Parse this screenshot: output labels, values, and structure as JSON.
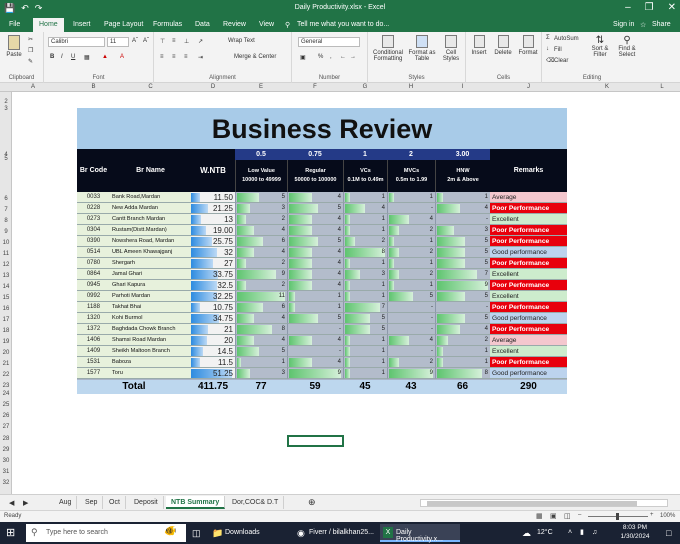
{
  "window": {
    "title": "Daily Productivity.xlsx - Excel"
  },
  "menu": {
    "file": "File",
    "tabs": [
      "Home",
      "Insert",
      "Page Layout",
      "Formulas",
      "Data",
      "Review",
      "View"
    ],
    "tell": "Tell me what you want to do...",
    "signin": "Sign in",
    "share": "Share"
  },
  "ribbon": {
    "paste": "Paste",
    "clipboard": "Clipboard",
    "font_name": "Calibri",
    "font_size": "11",
    "bold": "B",
    "italic": "I",
    "underline": "U",
    "font_label": "Font",
    "wrap": "Wrap Text",
    "merge": "Merge & Center",
    "alignment_label": "Alignment",
    "number_format": "General",
    "pct": "%",
    "comma": ",",
    "number_label": "Number",
    "conditional": "Conditional Formatting",
    "format_table": "Format as Table",
    "cell_styles": "Cell Styles",
    "styles_label": "Styles",
    "insert": "Insert",
    "delete": "Delete",
    "format": "Format",
    "cells_label": "Cells",
    "autosum": "AutoSum",
    "fill": "Fill",
    "clear": "Clear",
    "sort": "Sort & Filter",
    "find": "Find & Select",
    "editing_label": "Editing"
  },
  "columns": [
    "A",
    "B",
    "C",
    "D",
    "E",
    "F",
    "G",
    "H",
    "I",
    "J",
    "K",
    "L"
  ],
  "rows": [
    "2",
    "3",
    "4",
    "5",
    "6",
    "7",
    "8",
    "9",
    "10",
    "11",
    "12",
    "13",
    "14",
    "15",
    "16",
    "17",
    "18",
    "19",
    "20",
    "21",
    "22",
    "23",
    "24",
    "25",
    "26",
    "27",
    "28",
    "29",
    "30",
    "31",
    "32"
  ],
  "report": {
    "title": "Business Review",
    "headers": {
      "code": "Br Code",
      "name": "Br Name",
      "ntb": "W.NTB",
      "remarks": "Remarks"
    },
    "weights": [
      "0.5",
      "0.75",
      "1",
      "2",
      "3.00"
    ],
    "categories": [
      {
        "l1": "Low Value",
        "l2": "10000 to 49999"
      },
      {
        "l1": "Regular",
        "l2": "50000 to 100000"
      },
      {
        "l1": "VCs",
        "l2": "0.1M to 0.49m"
      },
      {
        "l1": "MVCs",
        "l2": "0.5m to 1.99"
      },
      {
        "l1": "HNW",
        "l2": "2m & Above"
      }
    ],
    "rows": [
      {
        "code": "0033",
        "name": "Bank Road,Mardan",
        "ntb": "11.50",
        "lv": "5",
        "reg": "4",
        "vc": "1",
        "mvc": "1",
        "hnw": "1",
        "remark": "Average"
      },
      {
        "code": "0228",
        "name": "New Adda Mardan",
        "ntb": "21.25",
        "lv": "3",
        "reg": "5",
        "vc": "4",
        "mvc": "-",
        "hnw": "4",
        "remark": "Poor Performance"
      },
      {
        "code": "0273",
        "name": "Cantt Branch Mardan",
        "ntb": "13",
        "lv": "2",
        "reg": "4",
        "vc": "1",
        "mvc": "4",
        "hnw": "-",
        "remark": "Excellent"
      },
      {
        "code": "0304",
        "name": "Rustam(Distt.Mardan)",
        "ntb": "19.00",
        "lv": "4",
        "reg": "4",
        "vc": "1",
        "mvc": "2",
        "hnw": "3",
        "remark": "Poor Performance"
      },
      {
        "code": "0390",
        "name": "Nowshera Road, Mardan",
        "ntb": "25.75",
        "lv": "6",
        "reg": "5",
        "vc": "2",
        "mvc": "1",
        "hnw": "5",
        "remark": "Poor Performance"
      },
      {
        "code": "0514",
        "name": "UBL Ameen Khawajganj",
        "ntb": "32",
        "lv": "4",
        "reg": "4",
        "vc": "8",
        "mvc": "2",
        "hnw": "5",
        "remark": "Good performance"
      },
      {
        "code": "0780",
        "name": "Shergarh",
        "ntb": "27",
        "lv": "2",
        "reg": "4",
        "vc": "1",
        "mvc": "1",
        "hnw": "5",
        "remark": "Poor Performance"
      },
      {
        "code": "0864",
        "name": "Jamal Ghari",
        "ntb": "33.75",
        "lv": "9",
        "reg": "4",
        "vc": "3",
        "mvc": "2",
        "hnw": "7",
        "remark": "Excellent"
      },
      {
        "code": "0945",
        "name": "Ghari Kapura",
        "ntb": "32.5",
        "lv": "2",
        "reg": "4",
        "vc": "1",
        "mvc": "1",
        "hnw": "9",
        "remark": "Poor Performance"
      },
      {
        "code": "0992",
        "name": "Parhoti Mardan",
        "ntb": "32.25",
        "lv": "11",
        "reg": "1",
        "vc": "1",
        "mvc": "5",
        "hnw": "5",
        "remark": "Excellent"
      },
      {
        "code": "1188",
        "name": "Takhat Bhai",
        "ntb": "10.75",
        "lv": "6",
        "reg": "1",
        "vc": "7",
        "mvc": "-",
        "hnw": "-",
        "remark": "Poor Performance"
      },
      {
        "code": "1320",
        "name": "Kohi Burmol",
        "ntb": "34.75",
        "lv": "4",
        "reg": "5",
        "vc": "5",
        "mvc": "-",
        "hnw": "5",
        "remark": "Good performance"
      },
      {
        "code": "1372",
        "name": "Baghdada Chowk Branch",
        "ntb": "21",
        "lv": "8",
        "reg": "-",
        "vc": "5",
        "mvc": "-",
        "hnw": "4",
        "remark": "Poor Performance"
      },
      {
        "code": "1406",
        "name": "Shamsi Road Mardan",
        "ntb": "20",
        "lv": "4",
        "reg": "4",
        "vc": "1",
        "mvc": "4",
        "hnw": "2",
        "remark": "Average"
      },
      {
        "code": "1409",
        "name": "Sheikh Maltoon Branch",
        "ntb": "14.5",
        "lv": "5",
        "reg": "-",
        "vc": "1",
        "mvc": "-",
        "hnw": "1",
        "remark": "Excellent"
      },
      {
        "code": "1531",
        "name": "Baboza",
        "ntb": "11.5",
        "lv": "1",
        "reg": "4",
        "vc": "1",
        "mvc": "2",
        "hnw": "1",
        "remark": "Poor Performance"
      },
      {
        "code": "1577",
        "name": "Toru",
        "ntb": "51.25",
        "lv": "3",
        "reg": "9",
        "vc": "1",
        "mvc": "9",
        "hnw": "8",
        "remark": "Good performance"
      }
    ],
    "total": {
      "label": "Total",
      "ntb": "411.75",
      "lv": "77",
      "reg": "59",
      "vc": "45",
      "mvc": "43",
      "hnw": "66",
      "remarks": "290"
    }
  },
  "remark_colors": {
    "Average": "#f4c7ce",
    "Poor Performance": "#e8000c",
    "Excellent": "#cdeccd",
    "Good performance": "#bcd3ee"
  },
  "sheets": [
    "Aug",
    "Sep",
    "Oct",
    "Deposit",
    "NTB Summary",
    "Dor,COC& D.T"
  ],
  "status": {
    "ready": "Ready",
    "zoom": "100%"
  },
  "taskbar": {
    "search": "Type here to search",
    "downloads": "Downloads",
    "chrome": "Fiverr / bilalkhan25...",
    "excel": "Daily Productivity.x...",
    "weather": "12°C",
    "time": "8:03 PM",
    "date": "1/30/2024"
  }
}
